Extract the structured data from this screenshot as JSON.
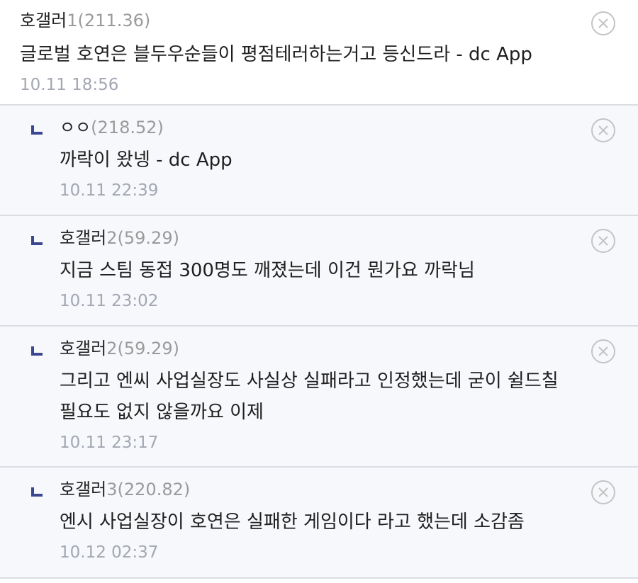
{
  "comments": [
    {
      "nick": "호갤러",
      "ip": "1(211.36)",
      "content": "글로벌 호연은 블두우순들이 평점테러하는거고 등신드라 - dc App",
      "date": "10.11 18:56"
    },
    {
      "nick": "ㅇㅇ",
      "ip": "(218.52)",
      "content": "까락이 왔넹 - dc App",
      "date": "10.11 22:39"
    },
    {
      "nick": "호갤러",
      "ip": "2(59.29)",
      "content": "지금 스팀 동접 300명도 깨졌는데 이건 뭔가요 까락님",
      "date": "10.11 23:02"
    },
    {
      "nick": "호갤러",
      "ip": "2(59.29)",
      "content": "그리고 엔씨 사업실장도 사실상 실패라고 인정했는데 굳이 쉴드칠 필요도 없지 않을까요 이제",
      "date": "10.11 23:17"
    },
    {
      "nick": "호갤러",
      "ip": "3(220.82)",
      "content": "엔시 사업실장이 호연은 실패한 게임이다 라고 했는데 소감좀",
      "date": "10.12 02:37"
    }
  ],
  "icons": {
    "delete": "close-circle-icon",
    "reply_marker": "reply-arrow-icon"
  },
  "colors": {
    "reply_marker": "#3b4890",
    "reply_background": "#f7f8fb",
    "date_text": "#a3a7b2",
    "ip_text": "#9a9a9a"
  }
}
